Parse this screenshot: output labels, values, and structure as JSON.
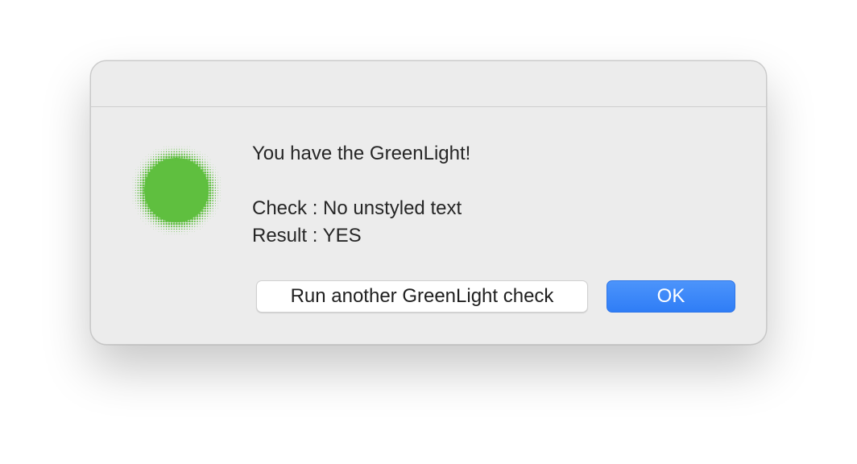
{
  "dialog": {
    "icon": "greenlight-halftone-circle-icon",
    "accent_color": "#5fbf3f",
    "messages": {
      "line1": "You have the GreenLight!",
      "line2": "Check : No unstyled text",
      "line3": "Result : YES"
    },
    "buttons": {
      "secondary_label": "Run another GreenLight check",
      "primary_label": "OK",
      "primary_color": "#3585f7"
    }
  }
}
